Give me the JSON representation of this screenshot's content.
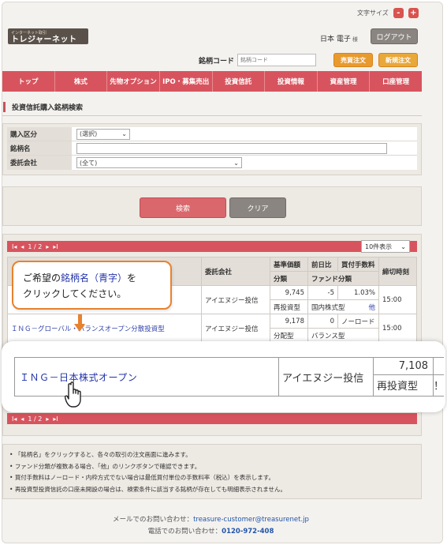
{
  "header": {
    "font_size_label": "文字サイズ",
    "font_minus": "-",
    "font_plus": "+",
    "logo_small": "インターネット取引",
    "logo_text": "トレジャーネット",
    "user_name": "日本 電子",
    "user_suffix": "様",
    "logout": "ログアウト",
    "code_label": "銘柄コード",
    "code_placeholder": "銘柄コード",
    "btn_trade": "売買注文",
    "btn_new": "新規注文"
  },
  "nav": [
    "トップ",
    "株式",
    "先物オプション",
    "IPO・募集売出",
    "投資信託",
    "投資情報",
    "資産管理",
    "口座管理"
  ],
  "page_title": "投資信託購入銘柄検索",
  "form": {
    "purchase_label": "購入区分",
    "purchase_value": "(選択)",
    "name_label": "銘柄名",
    "company_label": "委託会社",
    "company_value": "(全て)"
  },
  "buttons": {
    "search": "検索",
    "clear": "クリア"
  },
  "pager": {
    "text": "1 / 2",
    "per_page": "10件表示"
  },
  "table": {
    "h_company": "委託会社",
    "h_base": "基準価額",
    "h_diff": "前日比",
    "h_fee": "買付手数料",
    "h_deadline": "締切時刻",
    "h_class": "分類",
    "h_fundclass": "ファンド分類",
    "rows": [
      {
        "name": "",
        "company": "アイエヌジー投信",
        "price": "9,745",
        "diff": "-5",
        "fee": "1.03%",
        "class": "再投資型",
        "fund": "国内株式型",
        "other": "他",
        "deadline": "15:00"
      },
      {
        "name": "ＩＮＧ－グローバル・バランスオープン分散投資型",
        "company": "アイエヌジー投信",
        "price": "9,178",
        "diff": "0",
        "fee": "ノーロード",
        "class": "分配型",
        "fund": "バランス型",
        "other": "",
        "deadline": "15:00"
      }
    ]
  },
  "callout": {
    "line1_pre": "ご希望の",
    "line1_hl": "銘柄名（青字）",
    "line1_post": "を",
    "line2": "クリックしてください。"
  },
  "zoom": {
    "name": "ＩＮＧ－日本株式オープン",
    "company": "アイエヌジー投信",
    "price": "7,108",
    "type": "再投資型",
    "edge": "！"
  },
  "notes": [
    "「銘柄名」をクリックすると、各々の取引の注文画面に進みます。",
    "ファンド分類が複数ある場合、「他」のリンクボタンで確認できます。",
    "買付手数料はノーロード・内枠方式でない場合は最低買付単位の手数料率（税込）を表示します。",
    "再投資型投資信託の口座未開設の場合は、検索条件に該当する銘柄が存在しても明細表示されません。"
  ],
  "footer": {
    "mail_label": "メールでのお問い合わせ：",
    "mail": "treasure-customer@treasurenet.jp",
    "tel_label": "電話でのお問い合わせ：",
    "tel": "0120-972-408"
  },
  "colors": {
    "nav": "#d7545e",
    "accent": "#e8822e",
    "link": "#2233aa"
  }
}
